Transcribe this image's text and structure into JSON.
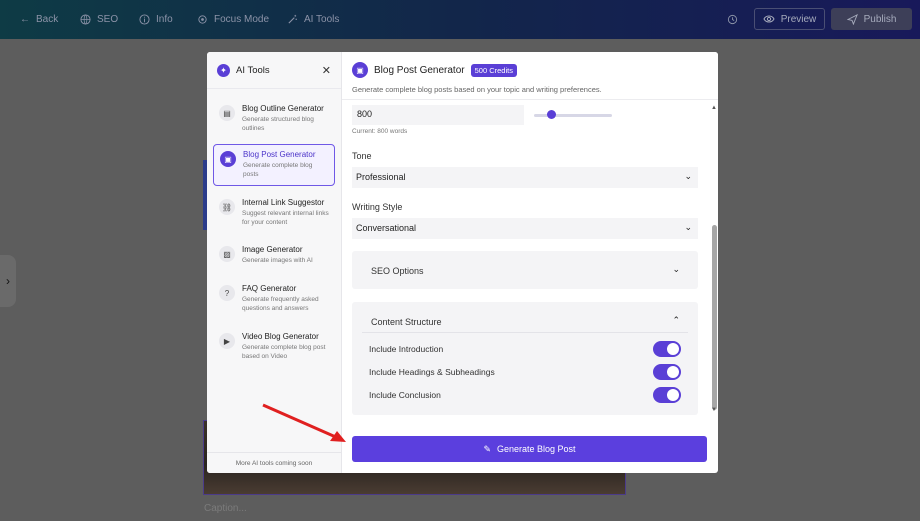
{
  "topbar": {
    "back": "Back",
    "seo": "SEO",
    "info": "Info",
    "focus_mode": "Focus Mode",
    "ai_tools": "AI Tools",
    "preview": "Preview",
    "publish": "Publish"
  },
  "editor": {
    "caption_placeholder": "Caption..."
  },
  "sidebar": {
    "title": "AI Tools",
    "tools": [
      {
        "name": "Blog Outline Generator",
        "desc": "Generate structured blog outlines",
        "icon": "document-icon"
      },
      {
        "name": "Blog Post Generator",
        "desc": "Generate complete blog posts",
        "icon": "blog-post-icon",
        "active": true
      },
      {
        "name": "Internal Link Suggestor",
        "desc": "Suggest relevant internal links for your content",
        "icon": "link-icon"
      },
      {
        "name": "Image Generator",
        "desc": "Generate images with AI",
        "icon": "image-icon"
      },
      {
        "name": "FAQ Generator",
        "desc": "Generate frequently asked questions and answers",
        "icon": "question-icon"
      },
      {
        "name": "Video Blog Generator",
        "desc": "Generate complete blog post based on Video",
        "icon": "video-icon"
      }
    ],
    "footer": "More AI tools coming soon"
  },
  "main": {
    "title": "Blog Post Generator",
    "credits": "500 Credits",
    "subtitle": "Generate complete blog posts based on your topic and writing preferences.",
    "word_count": {
      "value": "800",
      "hint": "Current: 800 words",
      "level": 0.2
    },
    "tone": {
      "label": "Tone",
      "value": "Professional"
    },
    "writing_style": {
      "label": "Writing Style",
      "value": "Conversational"
    },
    "seo_options": {
      "label": "SEO Options"
    },
    "content_structure": {
      "label": "Content Structure",
      "toggles": [
        {
          "label": "Include Introduction",
          "on": true
        },
        {
          "label": "Include Headings & Subheadings",
          "on": true
        },
        {
          "label": "Include Conclusion",
          "on": true
        }
      ]
    },
    "generate_button": "Generate Blog Post"
  },
  "colors": {
    "accent": "#5a3fd6",
    "annotation_arrow": "#e02020"
  }
}
